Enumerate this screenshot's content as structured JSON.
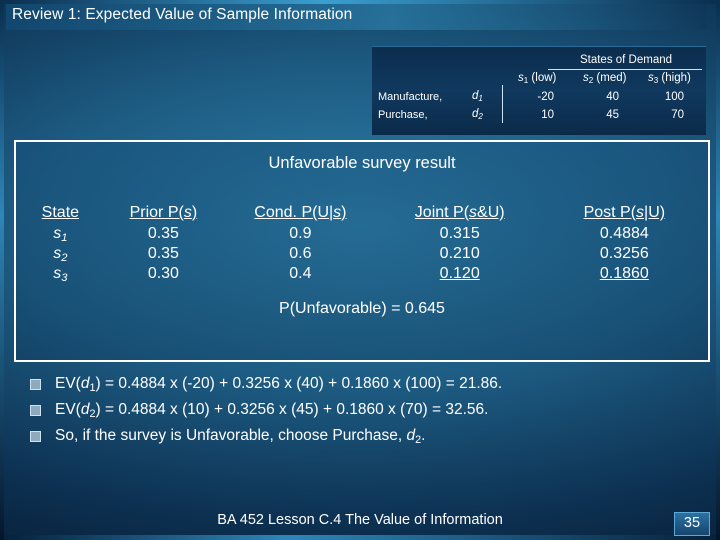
{
  "slide": {
    "title": "Review 1: Expected Value of Sample Information",
    "footer": "BA 452  Lesson C.4 The Value of Information",
    "page_number": "35"
  },
  "payoff_table": {
    "group_header": "States of Demand",
    "column_headers": [
      "s1 (low)",
      "s2 (med)",
      "s3 (high)"
    ],
    "rows": [
      {
        "label": "Manufacture,",
        "alternative": "d1",
        "values": [
          "-20",
          "40",
          "100"
        ]
      },
      {
        "label": "Purchase,",
        "alternative": "d2",
        "values": [
          "10",
          "45",
          "70"
        ]
      }
    ]
  },
  "survey": {
    "heading": "Unfavorable survey result",
    "headers": [
      "State",
      "Prior P(s)",
      "Cond. P(U|s)",
      "Joint P(s&U)",
      "Post P(s|U)"
    ],
    "rows": [
      {
        "state": "s1",
        "prior": "0.35",
        "cond": "0.9",
        "joint": "0.315",
        "post": "0.4884"
      },
      {
        "state": "s2",
        "prior": "0.35",
        "cond": "0.6",
        "joint": "0.210",
        "post": "0.3256"
      },
      {
        "state": "s3",
        "prior": "0.30",
        "cond": "0.4",
        "joint": "0.120",
        "post": "0.1860"
      }
    ],
    "total_label": "P(Unfavorable)",
    "total_value": "= 0.645"
  },
  "bullets": [
    "EV(d1) = 0.4884 x (-20) + 0.3256 x (40) + 0.1860 x (100) = 21.86.",
    "EV(d2) = 0.4884 x (10) + 0.3256 x (45) + 0.1860 x (70) = 32.56.",
    "So, if the survey is Unfavorable, choose Purchase, d2."
  ]
}
